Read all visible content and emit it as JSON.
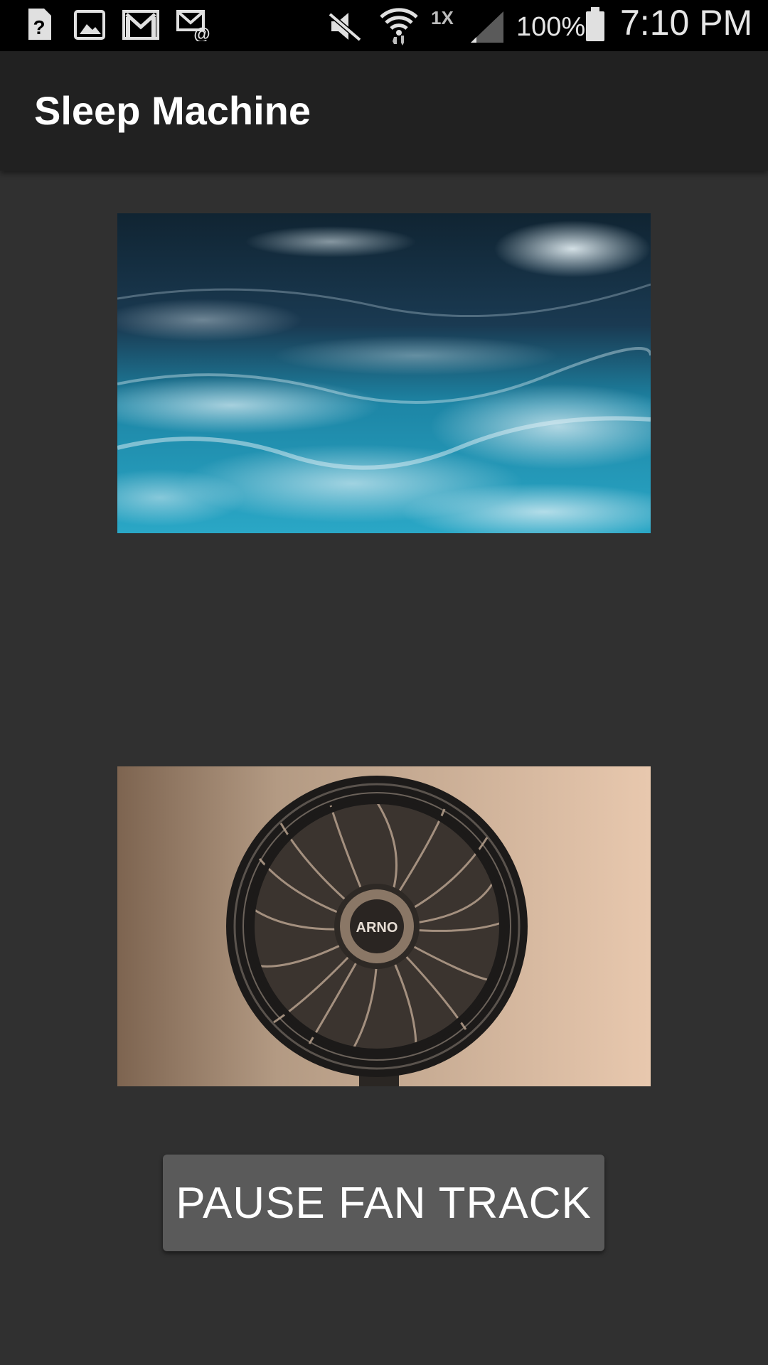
{
  "status_bar": {
    "icons": [
      "help-notification-icon",
      "image-notification-icon",
      "gmail-notification-icon",
      "email-notification-icon",
      "mute-icon",
      "wifi-icon",
      "signal-icon",
      "battery-icon"
    ],
    "network_label": "1X",
    "battery_percent": "100%",
    "time": "7:10 PM"
  },
  "app_bar": {
    "title": "Sleep Machine",
    "background": "#212121"
  },
  "main": {
    "ocean_image": {
      "name": "ocean waves image"
    },
    "fan_image": {
      "name": "electric fan image",
      "brand_text": "ARNO"
    },
    "pause_button": {
      "label": "PAUSE FAN TRACK",
      "color": "#5a5a5a"
    }
  },
  "colors": {
    "background": "#303030",
    "status_bar": "#000000",
    "text": "#ffffff"
  }
}
